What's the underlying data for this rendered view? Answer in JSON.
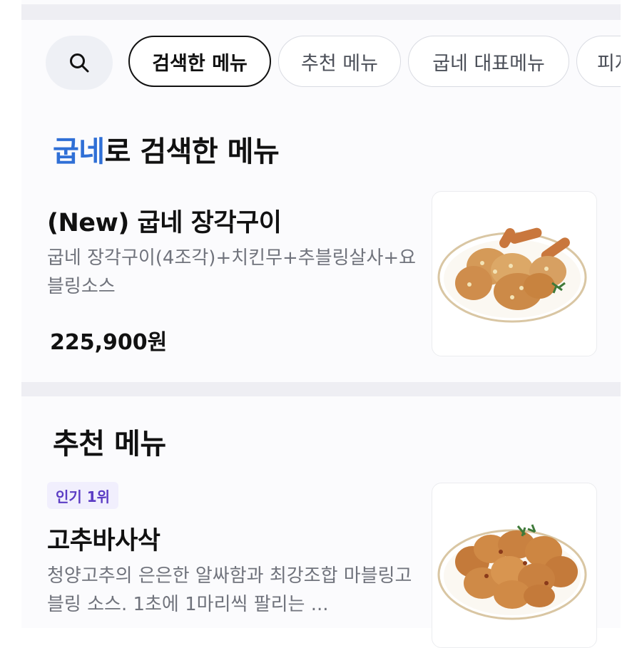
{
  "chips": {
    "searched": "검색한 메뉴",
    "recommended": "추천 메뉴",
    "signature": "굽네 대표메뉴",
    "partial": "피자"
  },
  "search_section": {
    "highlight": "굽네",
    "title_rest": "로 검색한 메뉴"
  },
  "item1": {
    "name": "(New) 굽네 장각구이",
    "desc": "굽네 장각구이(4조각)+치킨무+추블링살사+요블링소스",
    "price": "225,900원",
    "image_icon": "roasted-chicken-legs-plate"
  },
  "recommend_section": {
    "title": "추천 메뉴"
  },
  "item2": {
    "badge": "인기 1위",
    "name": "고추바사삭",
    "desc": "청양고추의 은은한 알싸함과 최강조합 마블링고블링 소스. 1초에 1마리씩 팔리는 ...",
    "image_icon": "fried-chicken-plate"
  },
  "colors": {
    "accent_blue": "#2f6fd6",
    "badge_bg": "#f1effd",
    "badge_text": "#5b3cc4",
    "page_bg": "#fbfbfd"
  }
}
